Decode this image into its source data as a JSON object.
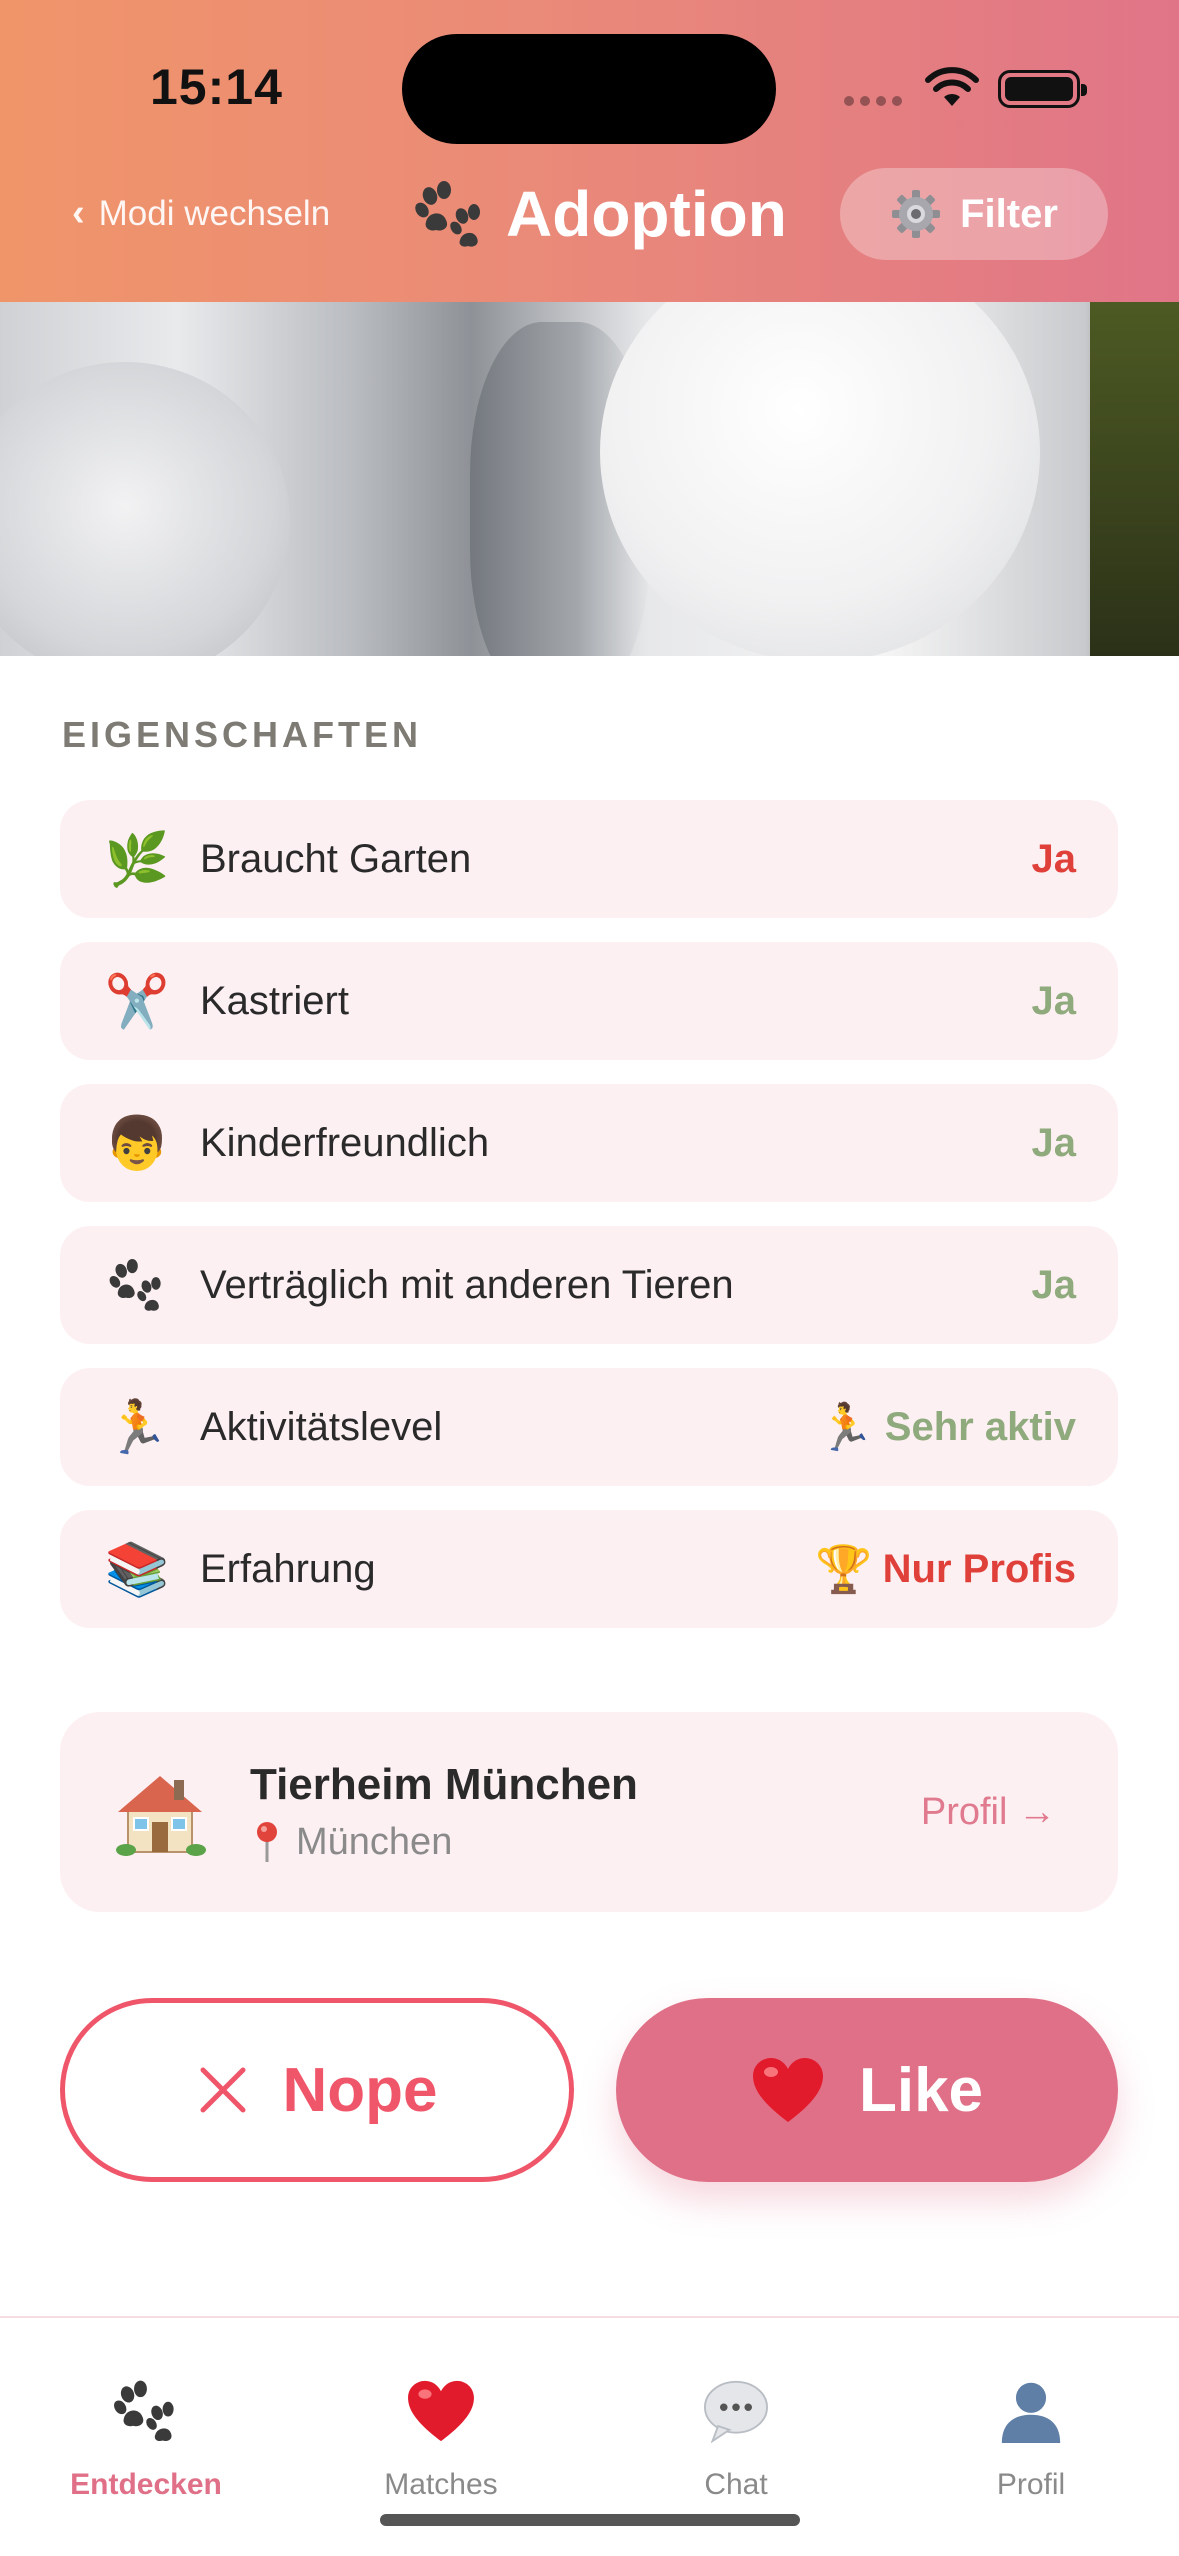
{
  "status_bar": {
    "time": "15:14"
  },
  "header": {
    "back_label": "Modi wechseln",
    "title": "Adoption",
    "filter_label": "Filter"
  },
  "traits": {
    "section_title": "EIGENSCHAFTEN",
    "items": [
      {
        "icon": "herb-icon",
        "emoji": "🌿",
        "label": "Braucht Garten",
        "value": "Ja",
        "value_color": "#e0403a"
      },
      {
        "icon": "scissors-icon",
        "emoji": "✂️",
        "label": "Kastriert",
        "value": "Ja",
        "value_color": "#8faa7c"
      },
      {
        "icon": "child-face-icon",
        "emoji": "👦",
        "label": "Kinderfreundlich",
        "value": "Ja",
        "value_color": "#8faa7c"
      },
      {
        "icon": "paw-icon",
        "emoji": "🐾",
        "label": "Verträglich mit anderen Tieren",
        "value": "Ja",
        "value_color": "#8faa7c"
      },
      {
        "icon": "runner-icon",
        "emoji": "🏃",
        "label": "Aktivitätslevel",
        "value": "Sehr aktiv",
        "value_icon": "runner-icon",
        "value_emoji": "🏃",
        "value_color": "#8faa7c"
      },
      {
        "icon": "books-icon",
        "emoji": "📚",
        "label": "Erfahrung",
        "value": "Nur Profis",
        "value_icon": "trophy-icon",
        "value_emoji": "🏆",
        "value_color": "#e0403a"
      }
    ]
  },
  "shelter": {
    "name": "Tierheim München",
    "location": "München",
    "profile_link": "Profil →"
  },
  "actions": {
    "nope_label": "Nope",
    "like_label": "Like"
  },
  "tabs": [
    {
      "label": "Entdecken",
      "icon": "paw-icon",
      "active": true
    },
    {
      "label": "Matches",
      "icon": "heart-icon",
      "active": false
    },
    {
      "label": "Chat",
      "icon": "speech-bubble-icon",
      "active": false
    },
    {
      "label": "Profil",
      "icon": "person-silhouette-icon",
      "active": false
    }
  ],
  "colors": {
    "header_gradient_start": "#f0956a",
    "header_gradient_end": "#e07588",
    "accent_pink": "#e07088",
    "nope_red": "#f0566a",
    "yes_green": "#8faa7c",
    "warn_red": "#e0403a",
    "card_bg": "#fdf0f2"
  }
}
